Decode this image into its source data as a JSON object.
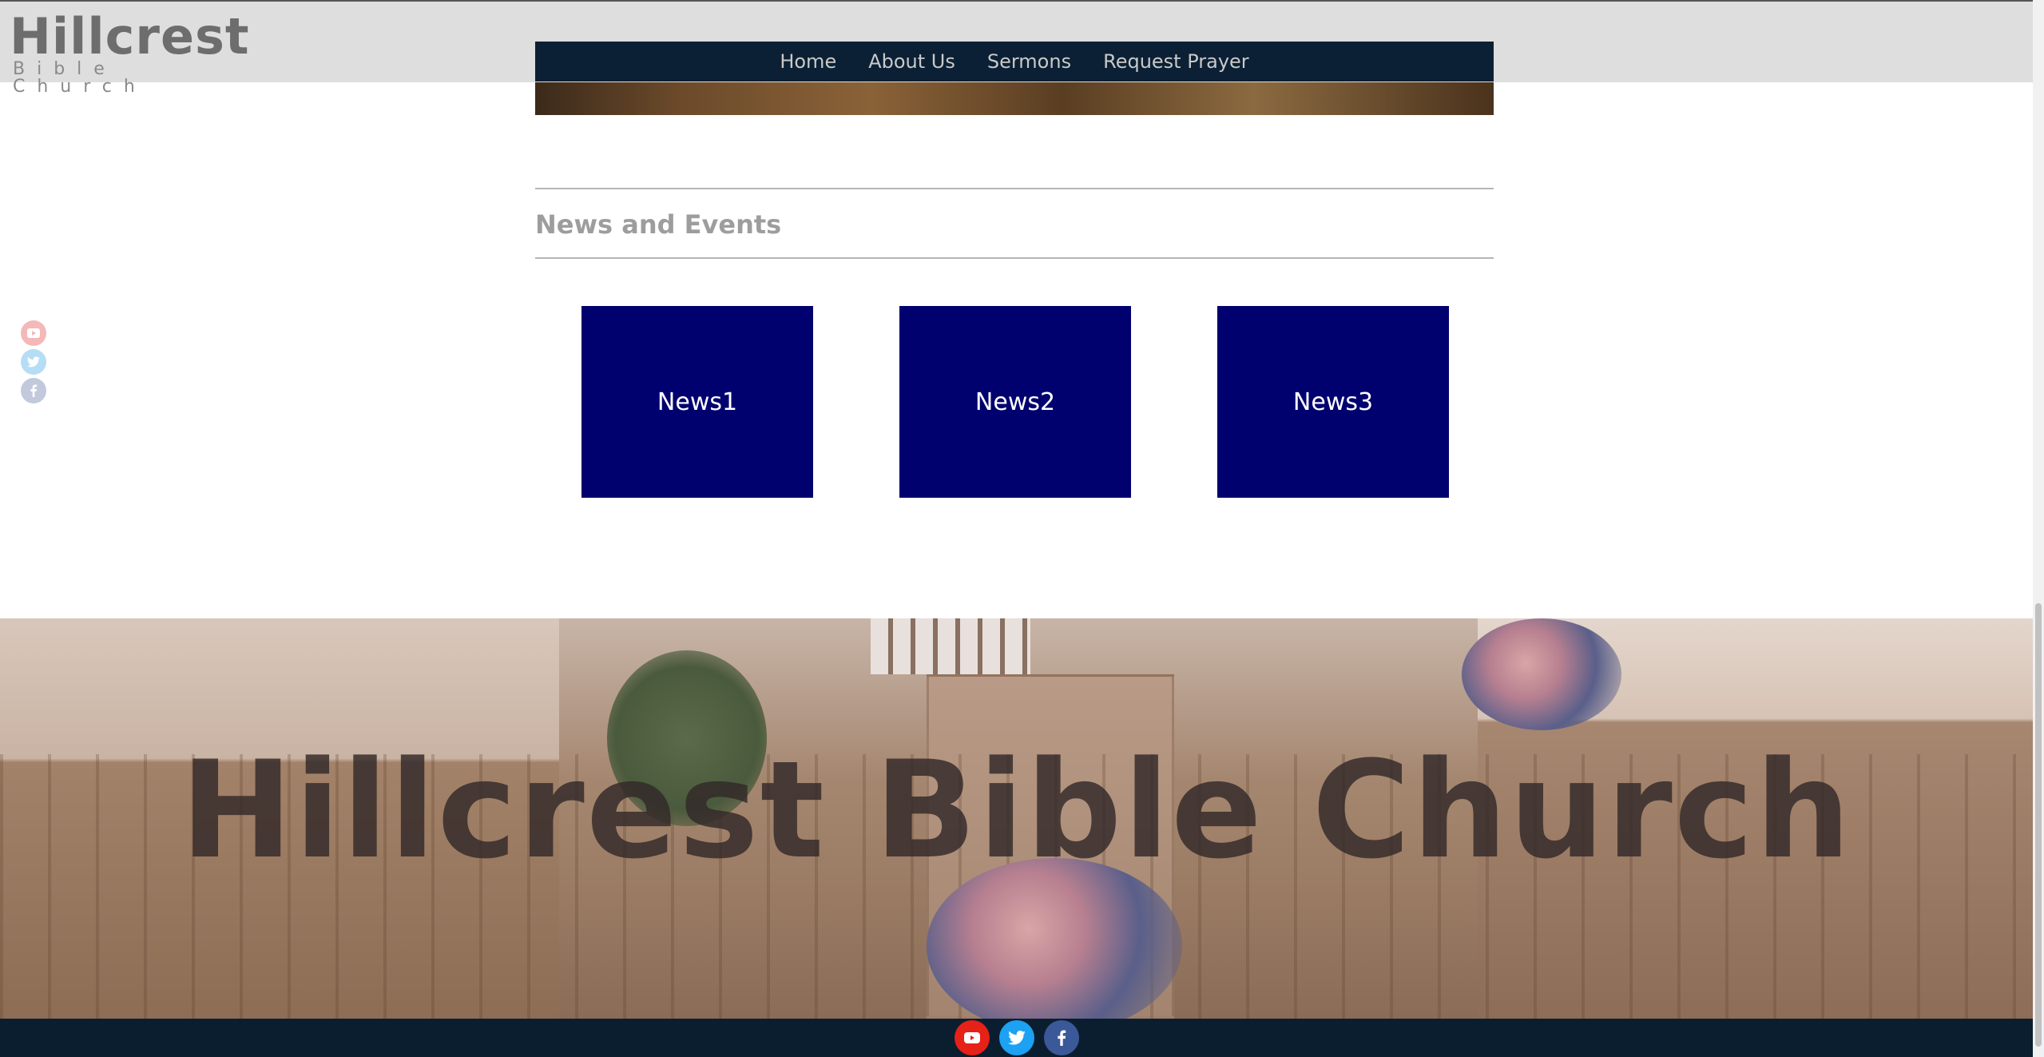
{
  "header": {
    "logo_main": "Hillcrest",
    "logo_sub": "Bible Church"
  },
  "nav": {
    "items": [
      {
        "label": "Home"
      },
      {
        "label": "About Us"
      },
      {
        "label": "Sermons"
      },
      {
        "label": "Request Prayer"
      }
    ]
  },
  "news": {
    "title": "News and Events",
    "cards": [
      {
        "label": "News1"
      },
      {
        "label": "News2"
      },
      {
        "label": "News3"
      }
    ]
  },
  "banner": {
    "title": "Hillcrest Bible Church"
  },
  "social": {
    "icons": [
      "youtube-icon",
      "twitter-icon",
      "facebook-icon"
    ],
    "colors": {
      "youtube": "#e62117",
      "twitter": "#1da1f2",
      "facebook": "#3b5998"
    }
  },
  "colors": {
    "nav_bg": "#0b2034",
    "news_card": "#00006f",
    "footer_bg": "#0b1e30"
  }
}
